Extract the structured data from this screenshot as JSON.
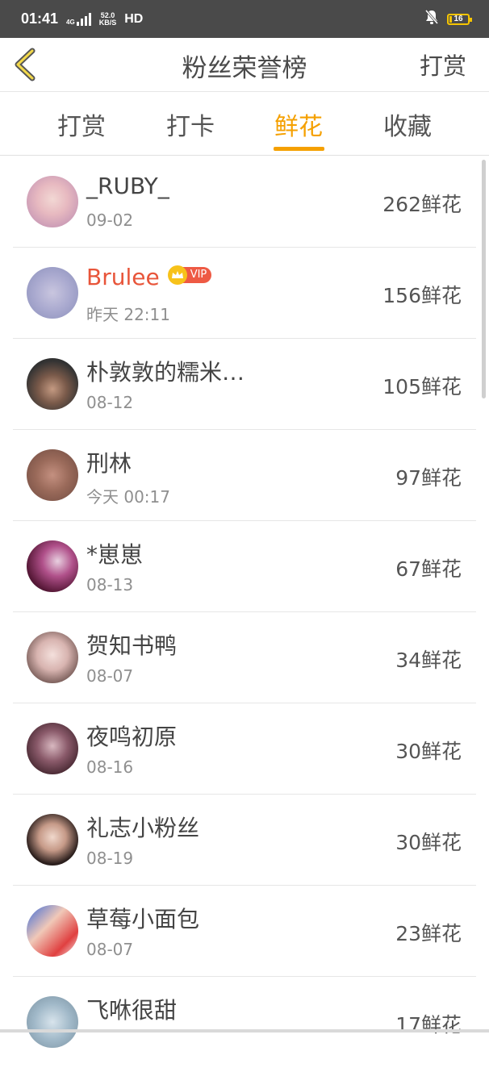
{
  "status": {
    "time": "01:41",
    "network": "4G",
    "speed_value": "52.0",
    "speed_unit": "KB/S",
    "hd": "HD",
    "battery": "16"
  },
  "header": {
    "title": "粉丝荣誉榜",
    "action": "打赏"
  },
  "tabs": [
    "打赏",
    "打卡",
    "鲜花",
    "收藏"
  ],
  "active_tab": "鲜花",
  "vip_label": "VIP",
  "fans": [
    {
      "name": "_RUBY_",
      "date": "09-02",
      "count": "262鲜花"
    },
    {
      "name": "Brulee",
      "date": "昨天 22:11",
      "count": "156鲜花",
      "vip": true
    },
    {
      "name": "朴敦敦的糯米…",
      "date": "08-12",
      "count": "105鲜花"
    },
    {
      "name": "刑林",
      "date": "今天 00:17",
      "count": "97鲜花"
    },
    {
      "name": "*崽崽",
      "date": "08-13",
      "count": "67鲜花"
    },
    {
      "name": "贺知书鸭",
      "date": "08-07",
      "count": "34鲜花"
    },
    {
      "name": "夜鸣初原",
      "date": "08-16",
      "count": "30鲜花"
    },
    {
      "name": "礼志小粉丝",
      "date": "08-19",
      "count": "30鲜花"
    },
    {
      "name": "草莓小面包",
      "date": "08-07",
      "count": "23鲜花"
    },
    {
      "name": "飞咻很甜",
      "date": "",
      "count": "17鲜花"
    }
  ],
  "colors": {
    "accent": "#f5a000",
    "vip_name": "#e8553a",
    "status_bar": "#4a4a4a"
  }
}
